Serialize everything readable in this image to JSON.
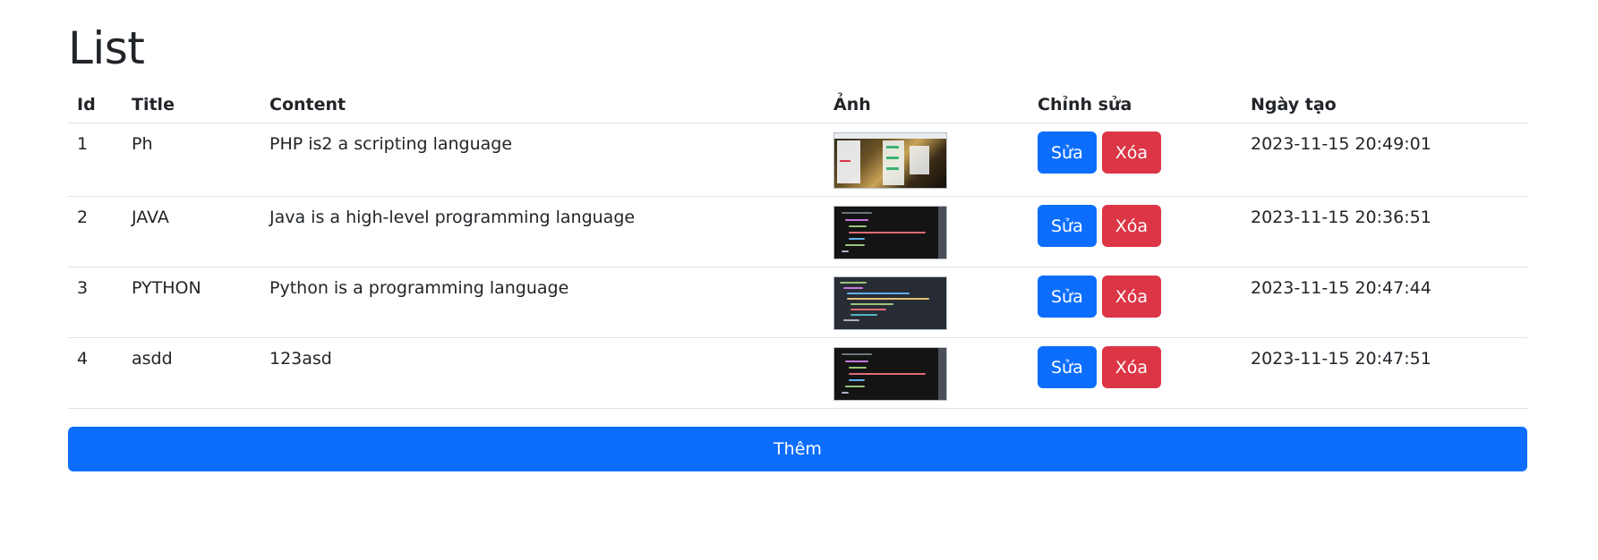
{
  "page": {
    "title": "List"
  },
  "table": {
    "headers": [
      "Id",
      "Title",
      "Content",
      "Ảnh",
      "Chỉnh sửa",
      "Ngày tạo"
    ],
    "rows": [
      {
        "id": "1",
        "title": "Ph",
        "content": "PHP is2 a scripting language",
        "image": "screenshot-thumbnail",
        "date": "2023-11-15 20:49:01"
      },
      {
        "id": "2",
        "title": "JAVA",
        "content": "Java is a high-level programming language",
        "image": "code-thumbnail",
        "date": "2023-11-15 20:36:51"
      },
      {
        "id": "3",
        "title": "PYTHON",
        "content": "Python is a programming language",
        "image": "code-thumbnail",
        "date": "2023-11-15 20:47:44"
      },
      {
        "id": "4",
        "title": "asdd",
        "content": "123asd",
        "image": "code-thumbnail",
        "date": "2023-11-15 20:47:51"
      }
    ],
    "edit_label": "Sửa",
    "delete_label": "Xóa"
  },
  "add_button": {
    "label": "Thêm"
  },
  "colors": {
    "primary": "#0d6efd",
    "danger": "#dc3545",
    "border": "#dee2e6",
    "text": "#212529"
  }
}
